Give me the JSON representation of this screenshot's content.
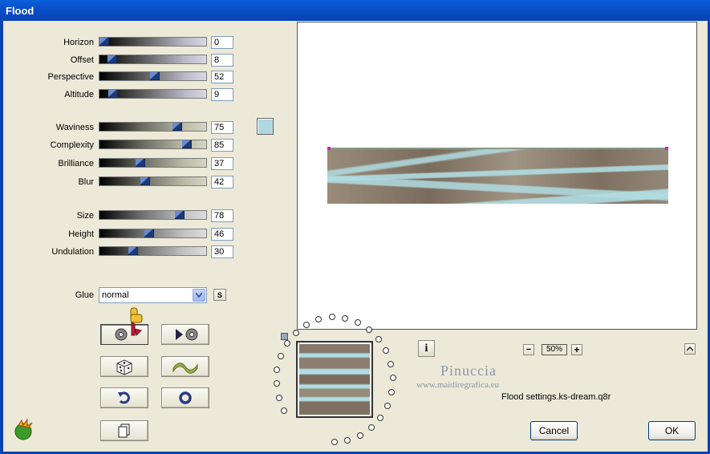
{
  "window": {
    "title": "Flood"
  },
  "sliders": [
    {
      "label": "Horizon",
      "value": "0",
      "level": 0
    },
    {
      "label": "Offset",
      "value": "8",
      "level": 8
    },
    {
      "label": "Perspective",
      "value": "52",
      "level": 52
    },
    {
      "label": "Altitude",
      "value": "9",
      "level": 9
    },
    {
      "label": "Waviness",
      "value": "75",
      "level": 75
    },
    {
      "label": "Complexity",
      "value": "85",
      "level": 85
    },
    {
      "label": "Brilliance",
      "value": "37",
      "level": 37
    },
    {
      "label": "Blur",
      "value": "42",
      "level": 42
    },
    {
      "label": "Size",
      "value": "78",
      "level": 78
    },
    {
      "label": "Height",
      "value": "46",
      "level": 46
    },
    {
      "label": "Undulation",
      "value": "30",
      "level": 30
    }
  ],
  "glue": {
    "label": "Glue",
    "value": "normal",
    "s_button": "S"
  },
  "preview": {
    "zoom": "50%",
    "zoom_minus": "−",
    "zoom_plus": "+",
    "info": "i"
  },
  "watermark": {
    "name": "Pinuccia",
    "site": "www.maidiregrafica.eu"
  },
  "settings_file": "Flood settings.ks-dream.q8r",
  "buttons": {
    "cancel": "Cancel",
    "ok": "OK"
  },
  "colors": {
    "swatch": "#b0d8e0",
    "title_bar": "#0a4fc8"
  }
}
